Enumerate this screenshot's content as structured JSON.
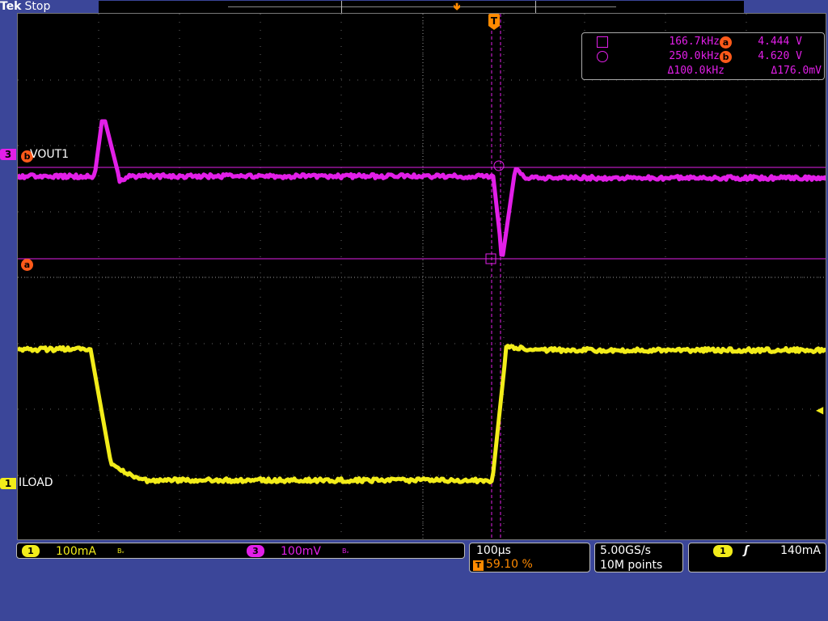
{
  "header": {
    "brand": "Tek",
    "acquisition_state": "Stop"
  },
  "colors": {
    "background": "#3b4699",
    "channel1": "#f2ec1a",
    "channel3": "#e21fe8",
    "cursor_badge": "#ff5a1a",
    "trigger": "#ff8a00"
  },
  "channels": {
    "ch1": {
      "number": "1",
      "label": "ILOAD",
      "scale": "100mA",
      "bandwidth_icon": "Bᵥ"
    },
    "ch3": {
      "number": "3",
      "label": "VOUT1",
      "scale": "100mV",
      "bandwidth_icon": "Bᵥ"
    }
  },
  "cursors": {
    "a_badge": "a",
    "b_badge": "b",
    "readout": {
      "a_freq": "166.7kHz",
      "a_volt": "4.444 V",
      "b_freq": "250.0kHz",
      "b_volt": "4.620 V",
      "delta_freq": "Δ100.0kHz",
      "delta_volt": "Δ176.0mV"
    }
  },
  "horizontal": {
    "time_per_div": "100µs",
    "trigger_marker": "T",
    "trigger_position": "59.10 %"
  },
  "acquisition": {
    "sample_rate": "5.00GS/s",
    "record_length": "10M points"
  },
  "trigger": {
    "source": "1",
    "slope_icon": "rising-edge",
    "slope_glyph": "ʃ",
    "level": "140mA",
    "level_marker": "◀"
  },
  "icons": {
    "cursor_a_symbol": "square-cursor-icon",
    "cursor_b_symbol": "circle-cursor-icon"
  }
}
